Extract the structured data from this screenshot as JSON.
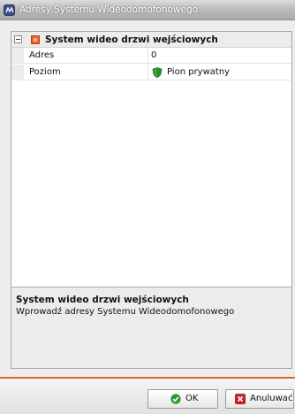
{
  "window": {
    "title": "Adresy Systemu Wideodomofonowego",
    "icon": "app-logo-icon"
  },
  "property_grid": {
    "category": {
      "title": "System wideo drzwi wejściowych",
      "expander_icon": "collapse-icon",
      "icon": "category-icon"
    },
    "rows": [
      {
        "name": "Adres",
        "value": "0"
      },
      {
        "name": "Poziom",
        "value": "Pion prywatny",
        "icon": "green-shield-icon"
      }
    ]
  },
  "description": {
    "title": "System wideo drzwi wejściowych",
    "text": "Wprowadź adresy Systemu Wideodomofonowego"
  },
  "buttons": {
    "ok": {
      "label": "OK",
      "icon": "green-check-icon"
    },
    "cancel": {
      "label": "Anuluwać",
      "icon": "red-x-icon"
    }
  },
  "colors": {
    "accent": "#e2622c",
    "ok_icon": "#2f9a2f",
    "cancel_icon": "#d42020",
    "shield": "#3aa33a"
  }
}
